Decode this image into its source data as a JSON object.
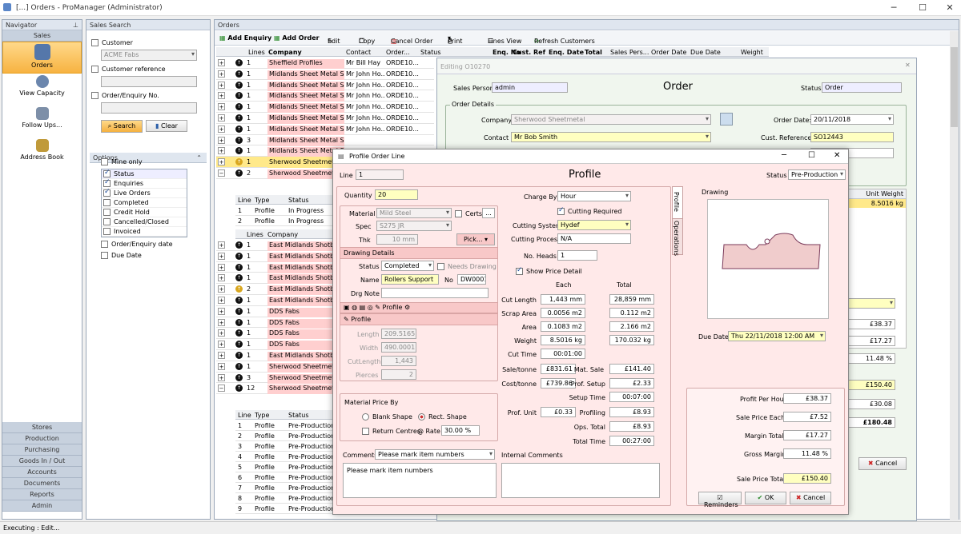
{
  "window": {
    "title": "[...] Orders - ProManager (Administrator)"
  },
  "navigator": {
    "header": "Navigator",
    "section_top": "Sales",
    "items": [
      {
        "label": "Orders",
        "icon": "orders-icon"
      },
      {
        "label": "View Capacity",
        "icon": "capacity-icon"
      },
      {
        "label": "Follow Ups...",
        "icon": "followups-icon"
      },
      {
        "label": "Address Book",
        "icon": "addressbook-icon"
      }
    ],
    "sections": [
      "Stores",
      "Production",
      "Purchasing",
      "Goods In / Out",
      "Accounts",
      "Documents",
      "Reports",
      "Admin"
    ]
  },
  "sales_search": {
    "header": "Sales Search",
    "customer_label": "Customer",
    "customer_value": "ACME Fabs",
    "customer_ref_label": "Customer reference",
    "order_no_label": "Order/Enquiry No.",
    "search_btn": "Search",
    "clear_btn": "Clear",
    "options_header": "Options",
    "mine_only": "Mine only",
    "status_items": [
      {
        "label": "Status",
        "checked": true
      },
      {
        "label": "Enquiries",
        "checked": true
      },
      {
        "label": "Live Orders",
        "checked": true
      },
      {
        "label": "Completed",
        "checked": false
      },
      {
        "label": "Credit Hold",
        "checked": false
      },
      {
        "label": "Cancelled/Closed",
        "checked": false
      },
      {
        "label": "Invoiced",
        "checked": false
      }
    ],
    "order_date": "Order/Enquiry date",
    "due_date": "Due Date"
  },
  "orders": {
    "header": "Orders",
    "toolbar": [
      "Add Enquiry",
      "Add Order",
      "Edit",
      "Copy",
      "Cancel Order",
      "Print",
      "Lines View",
      "Refresh Customers"
    ],
    "columns": [
      "Lines",
      "Company",
      "Contact",
      "Order...",
      "Status",
      "Enq. No",
      "Cust. Ref",
      "Enq. Date",
      "Total",
      "Sales Pers...",
      "Order Date",
      "Due Date",
      "Weight"
    ],
    "rows_top": [
      {
        "lines": "1",
        "company": "Sheffield Profiles",
        "contact": "Mr Bill Hay",
        "order": "ORDE10...",
        "pink": true
      },
      {
        "lines": "1",
        "company": "Midlands Sheet Metal Su...",
        "contact": "Mr John Ho...",
        "order": "ORDE10...",
        "pink": true
      },
      {
        "lines": "1",
        "company": "Midlands Sheet Metal Su...",
        "contact": "Mr John Ho...",
        "order": "ORDE10...",
        "pink": true
      },
      {
        "lines": "1",
        "company": "Midlands Sheet Metal Su...",
        "contact": "Mr John Ho...",
        "order": "ORDE10...",
        "pink": true
      },
      {
        "lines": "1",
        "company": "Midlands Sheet Metal Su...",
        "contact": "Mr John Ho...",
        "order": "ORDE10...",
        "pink": true
      },
      {
        "lines": "1",
        "company": "Midlands Sheet Metal Su...",
        "contact": "Mr John Ho...",
        "order": "ORDE10...",
        "pink": true
      },
      {
        "lines": "1",
        "company": "Midlands Sheet Metal Su...",
        "contact": "Mr John Ho...",
        "order": "ORDE10...",
        "pink": true
      },
      {
        "lines": "3",
        "company": "Midlands Sheet Metal S",
        "contact": "",
        "order": "",
        "pink": true
      },
      {
        "lines": "1",
        "company": "Midlands Sheet Metal S",
        "contact": "",
        "order": "",
        "pink": true
      },
      {
        "lines": "1",
        "company": "Sherwood Sheetmetal",
        "contact": "",
        "order": "",
        "pink": false,
        "yellow": true
      },
      {
        "lines": "2",
        "company": "Sherwood Sheetmetal",
        "contact": "",
        "order": "",
        "pink": true
      }
    ],
    "sub_columns": [
      "Line",
      "Type",
      "Status"
    ],
    "sub_rows_1": [
      {
        "line": "1",
        "type": "Profile",
        "status": "In Progress"
      },
      {
        "line": "2",
        "type": "Profile",
        "status": "In Progress"
      }
    ],
    "rows_mid": [
      {
        "lines": "1",
        "company": "East Midlands Shotblas"
      },
      {
        "lines": "1",
        "company": "East Midlands Shotblas"
      },
      {
        "lines": "1",
        "company": "East Midlands Shotblas"
      },
      {
        "lines": "1",
        "company": "East Midlands Shotblas"
      },
      {
        "lines": "2",
        "company": "East Midlands Shotblas"
      },
      {
        "lines": "1",
        "company": "East Midlands Shotblas"
      },
      {
        "lines": "1",
        "company": "DDS Fabs"
      },
      {
        "lines": "1",
        "company": "DDS Fabs"
      },
      {
        "lines": "1",
        "company": "DDS Fabs"
      },
      {
        "lines": "1",
        "company": "DDS Fabs"
      },
      {
        "lines": "1",
        "company": "East Midlands Shotblas"
      },
      {
        "lines": "1",
        "company": "Sherwood Sheetmetal"
      },
      {
        "lines": "3",
        "company": "Sherwood Sheetmetal"
      },
      {
        "lines": "12",
        "company": "Sherwood Sheetmetal"
      }
    ],
    "sub_rows_2": [
      {
        "line": "1",
        "type": "Profile",
        "status": "Pre-Production"
      },
      {
        "line": "2",
        "type": "Profile",
        "status": "Pre-Production"
      },
      {
        "line": "3",
        "type": "Profile",
        "status": "Pre-Production"
      },
      {
        "line": "4",
        "type": "Profile",
        "status": "Pre-Production"
      },
      {
        "line": "5",
        "type": "Profile",
        "status": "Pre-Production"
      },
      {
        "line": "6",
        "type": "Profile",
        "status": "Pre-Production"
      },
      {
        "line": "7",
        "type": "Profile",
        "status": "Pre-Production"
      },
      {
        "line": "8",
        "type": "Profile",
        "status": "Pre-Production"
      },
      {
        "line": "9",
        "type": "Profile",
        "status": "Pre-Production"
      }
    ]
  },
  "editing": {
    "title": "Editing O10270",
    "heading": "Order",
    "sales_person_label": "Sales Person",
    "sales_person": "admin",
    "status_label": "Status",
    "status": "Order",
    "details_label": "Order Details",
    "company_label": "Company",
    "company": "Sherwood Sheetmetal",
    "contact_label": "Contact",
    "contact": "Mr Bob Smith",
    "order_date_label": "Order Date:",
    "order_date": "20/11/2018",
    "cust_ref_label": "Cust. Reference:",
    "cust_ref": "SO12443",
    "unit_weight_label": "Unit Weight",
    "unit_weight": "8.5016 kg",
    "right_values": [
      "£38.37",
      "£17.27",
      "11.48 %",
      "£150.40",
      "£30.08",
      "£180.48"
    ],
    "cancel": "Cancel"
  },
  "dialog": {
    "title": "Profile Order Line",
    "heading": "Profile",
    "line_label": "Line",
    "line": "1",
    "status_label": "Status",
    "status": "Pre-Production",
    "quantity_label": "Quantity",
    "quantity": "20",
    "material_label": "Material",
    "material": "Mild Steel",
    "certs_label": "Certs",
    "spec_label": "Spec",
    "spec": "S275 JR",
    "thk_label": "Thk",
    "thk": "10 mm",
    "pick": "Pick...",
    "drawing_details": "Drawing Details",
    "dd_status_label": "Status",
    "dd_status": "Completed",
    "needs_drawing": "Needs Drawing",
    "name_label": "Name",
    "name": "Rollers Support",
    "no_label": "No",
    "no": "DW0001",
    "drg_note_label": "Drg Note",
    "tool_label": "Profile",
    "profile_bar": "Profile",
    "length_label": "Length",
    "length": "209.5165",
    "width_label": "Width",
    "width": "490.0001",
    "cutlength_label": "CutLength",
    "cutlength": "1,443",
    "pierces_label": "Pierces",
    "pierces": "2",
    "mat_price_by": "Material Price By",
    "blank_shape": "Blank Shape",
    "rect_shape": "Rect. Shape",
    "return_centres": "Return Centres",
    "at_rate_label": "@ Rate",
    "at_rate": "30.00 %",
    "charge_by_label": "Charge By",
    "charge_by": "Hour",
    "cutting_required": "Cutting Required",
    "cutting_system_label": "Cutting System",
    "cutting_system": "Hydef",
    "cutting_process_label": "Cutting Process",
    "cutting_process": "N/A",
    "no_heads_label": "No. Heads",
    "no_heads": "1",
    "show_price": "Show Price Detail",
    "each_label": "Each",
    "total_label": "Total",
    "cut_length_label": "Cut Length",
    "cut_length_each": "1,443 mm",
    "cut_length_total": "28,859 mm",
    "scrap_area_label": "Scrap Area",
    "scrap_area_each": "0.0056 m2",
    "scrap_area_total": "0.112 m2",
    "area_label": "Area",
    "area_each": "0.1083 m2",
    "area_total": "2.166 m2",
    "weight_label": "Weight",
    "weight_each": "8.5016 kg",
    "weight_total": "170.032 kg",
    "cut_time_label": "Cut Time",
    "cut_time": "00:01:00",
    "sale_tonne_label": "Sale/tonne",
    "sale_tonne": "£831.61",
    "mat_sale_label": "Mat. Sale",
    "mat_sale": "£141.40",
    "cost_tonne_label": "Cost/tonne",
    "cost_tonne": "£739.86",
    "prof_setup_label": "Prof. Setup",
    "prof_setup": "£2.33",
    "setup_time_label": "Setup Time",
    "setup_time": "00:07:00",
    "prof_unit_label": "Prof. Unit",
    "prof_unit": "£0.33",
    "profiling_label": "Profiling",
    "profiling": "£8.93",
    "ops_total_label": "Ops. Total",
    "ops_total": "£8.93",
    "total_time_label": "Total Time",
    "total_time": "00:27:00",
    "comments_label": "Comments",
    "comments_select": "Please mark item numbers",
    "comments_text": "Please mark item numbers",
    "internal_comments_label": "Internal Comments",
    "tab_profile": "Profile",
    "tab_operations": "Operations",
    "drawing_label": "Drawing",
    "due_date_label": "Due Date",
    "due_date": "Thu  22/11/2018 12:00  AM",
    "profit_hour_label": "Profit Per Hour",
    "profit_hour": "£38.37",
    "sale_each_label": "Sale Price Each",
    "sale_each": "£7.52",
    "margin_total_label": "Margin Total",
    "margin_total": "£17.27",
    "gross_margin_label": "Gross Margin",
    "gross_margin": "11.48 %",
    "sale_total_label": "Sale Price Total",
    "sale_total": "£150.40",
    "reminders": "Reminders",
    "ok": "OK",
    "cancel": "Cancel"
  },
  "statusbar": {
    "text": "Executing : Edit..."
  }
}
